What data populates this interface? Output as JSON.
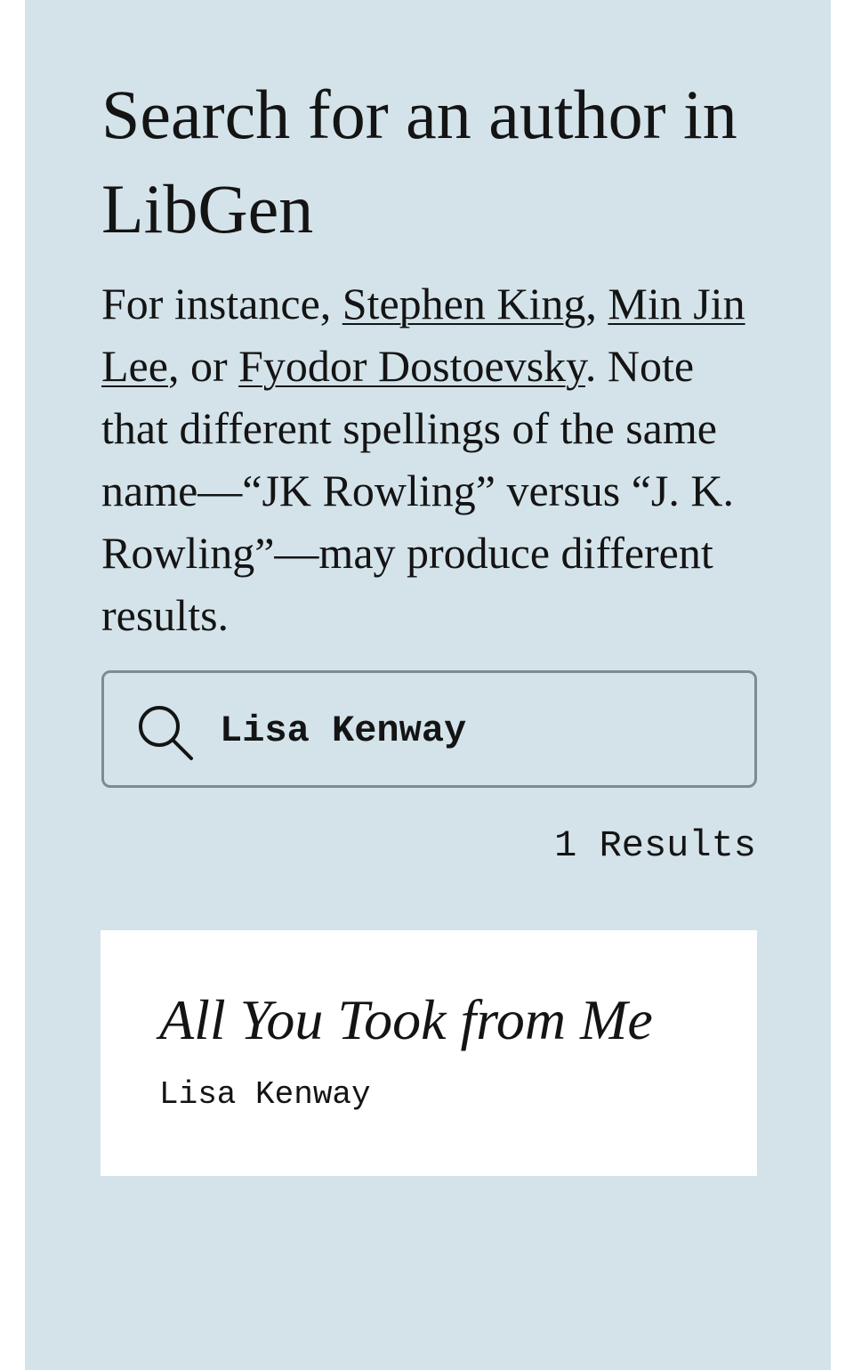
{
  "header": {
    "title": "Search for an author in LibGen"
  },
  "intro": {
    "prefix": "For instance, ",
    "links": [
      "Stephen King",
      "Min Jin Lee",
      "Fyodor Dostoevsky"
    ],
    "sep1": ", ",
    "sep2": ", or ",
    "suffix": ". Note that different spellings of the same name—“JK Rowling” versus “J. K. Rowling”—may produce different results."
  },
  "search": {
    "icon": "search-icon",
    "value": "Lisa Kenway"
  },
  "results": {
    "count_label": "1 Results",
    "items": [
      {
        "title": "All You Took from Me",
        "author": "Lisa Kenway"
      }
    ]
  },
  "colors": {
    "panel_background": "#d4e3ea",
    "card_background": "#ffffff",
    "text": "#141414",
    "input_border": "#7f8a90"
  }
}
